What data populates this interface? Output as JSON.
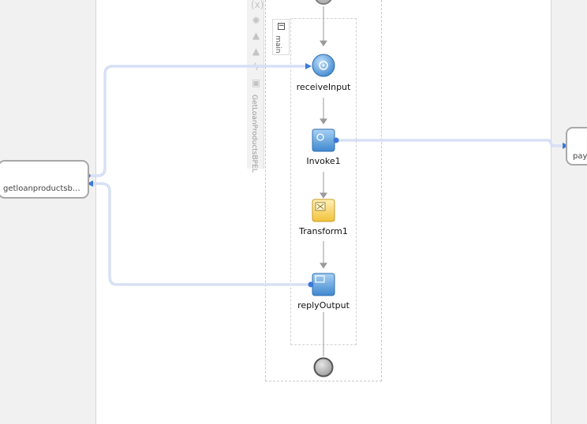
{
  "composite": {
    "service": {
      "name": "getloanproductsb…"
    },
    "reference": {
      "name": "pay"
    }
  },
  "bpel": {
    "process_name": "GetLoanProductsBPEL",
    "scope_name": "main",
    "collapse_symbol": "−",
    "activities": [
      {
        "name": "receiveInput",
        "type": "receive"
      },
      {
        "name": "Invoke1",
        "type": "invoke"
      },
      {
        "name": "Transform1",
        "type": "transform"
      },
      {
        "name": "replyOutput",
        "type": "reply"
      }
    ]
  },
  "toolbar": {
    "icons": [
      "variables-icon",
      "gear-icon",
      "warning-icon",
      "throw-icon",
      "flash-icon",
      "catch-icon"
    ]
  },
  "colors": {
    "wire": "#b8c8ee",
    "wire_inner": "#dde6f8",
    "connector_blue": "#3d78d8",
    "activity_blue": "#5a9bdc",
    "transform_yellow": "#f5cf58",
    "gray_node": "#a9a9a9"
  }
}
